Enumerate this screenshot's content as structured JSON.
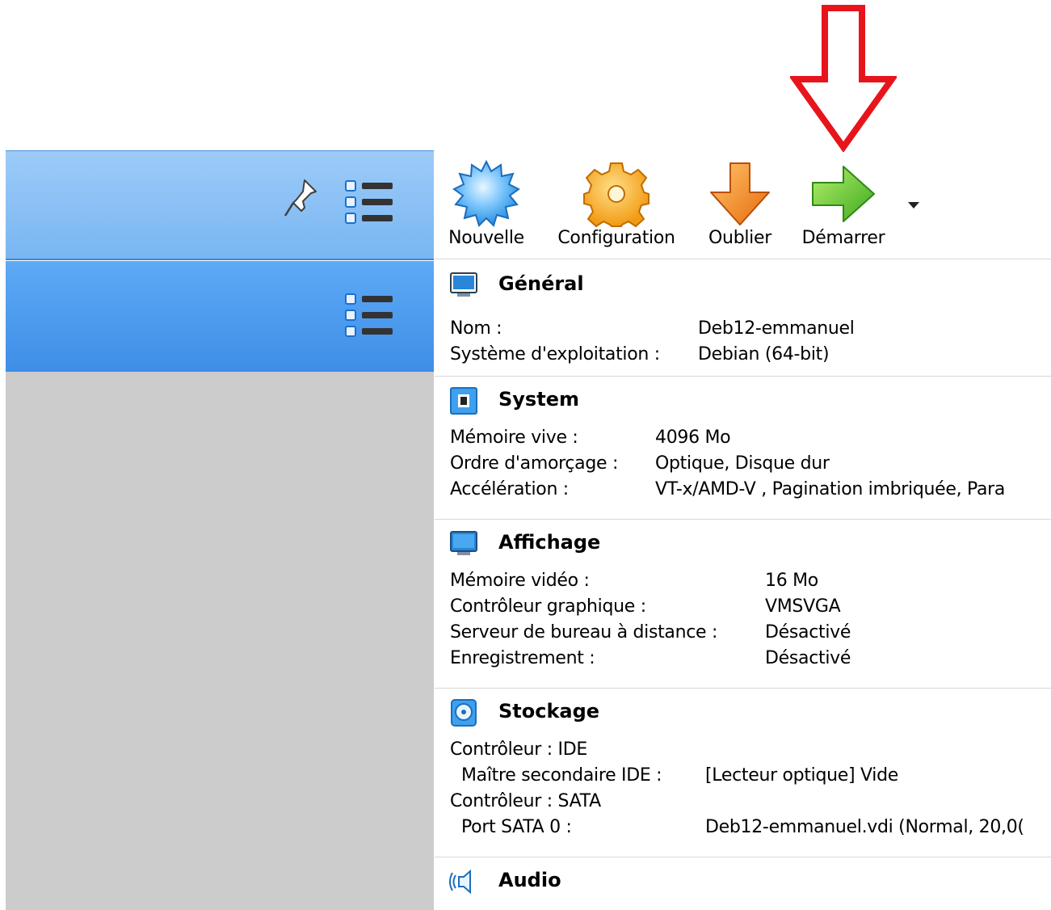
{
  "toolbar": {
    "new_label": "Nouvelle",
    "config_label": "Configuration",
    "forget_label": "Oublier",
    "start_label": "Démarrer"
  },
  "general": {
    "title": "Général",
    "name_key": "Nom :",
    "name_val": "Deb12-emmanuel",
    "os_key": "Système d'exploitation :",
    "os_val": "Debian (64-bit)"
  },
  "system": {
    "title": "System",
    "ram_key": "Mémoire vive :",
    "ram_val": "4096 Mo",
    "boot_key": "Ordre d'amorçage :",
    "boot_val": "Optique, Disque dur",
    "accel_key": "Accélération :",
    "accel_val": "VT-x/AMD-V , Pagination imbriquée, Para"
  },
  "display": {
    "title": "Affichage",
    "vram_key": "Mémoire vidéo :",
    "vram_val": "16 Mo",
    "gfx_key": "Contrôleur graphique :",
    "gfx_val": "VMSVGA",
    "rdp_key": "Serveur de bureau à distance :",
    "rdp_val": "Désactivé",
    "rec_key": "Enregistrement :",
    "rec_val": "Désactivé"
  },
  "storage": {
    "title": "Stockage",
    "ctrl_ide": "Contrôleur : IDE",
    "ide_key": "Maître secondaire IDE :",
    "ide_val": "[Lecteur optique] Vide",
    "ctrl_sata": "Contrôleur : SATA",
    "sata_key": "Port SATA 0 :",
    "sata_val": "Deb12-emmanuel.vdi (Normal, 20,0("
  },
  "audio": {
    "title": "Audio"
  },
  "colors": {
    "annotation_arrow": "#e8141c",
    "toolbar_row_top": "#8cc2f6",
    "toolbar_row_selected": "#4a96ec",
    "left_panel_bg": "#cccccc"
  }
}
